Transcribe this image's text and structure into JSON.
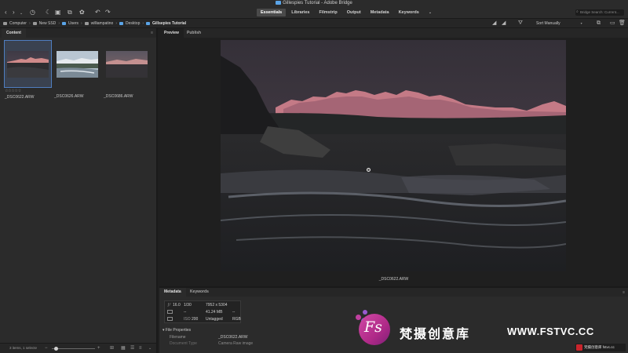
{
  "window": {
    "title": "Gillespies Tutorial - Adobe Bridge"
  },
  "toolbar": {
    "workspaces": [
      "Essentials",
      "Libraries",
      "Filmstrip",
      "Output",
      "Metadata",
      "Keywords"
    ],
    "active_workspace": "Essentials",
    "search_placeholder": "Bridge Search: Current..."
  },
  "pathbar": {
    "crumbs": [
      "Computer",
      "New SSD",
      "Users",
      "williampatino",
      "Desktop",
      "Gillsepies Tutorial"
    ],
    "sort_label": "Sort Manually"
  },
  "content_panel": {
    "tab": "Content",
    "items": [
      {
        "filename": "_DSC0622.ARW",
        "selected": true,
        "stars": "☆☆☆☆☆"
      },
      {
        "filename": "_DSC0626.ARW",
        "selected": false,
        "stars": ""
      },
      {
        "filename": "_DSC0686.ARW",
        "selected": false,
        "stars": ""
      }
    ],
    "status": "3 items, 1 selecte"
  },
  "preview_panel": {
    "tabs": [
      "Preview",
      "Publish"
    ],
    "active_tab": "Preview",
    "filename": "_DSC0622.ARW"
  },
  "metadata_panel": {
    "tabs": [
      "Metadata",
      "Keywords"
    ],
    "active_tab": "Metadata",
    "camera": {
      "aperture": "16.0",
      "shutter": "1/30",
      "dimensions": "7952 x 5304",
      "exposure_comp": "--",
      "file_size": "41.24 MB",
      "dpi": "--",
      "iso": "200",
      "label": "Untagged",
      "color_mode": "RGB"
    },
    "section": "File Properties",
    "rows": [
      {
        "label": "Filename",
        "value": "_DSC0622.ARW"
      },
      {
        "label": "Document Type",
        "value": "Camera Raw image"
      }
    ]
  },
  "watermark": {
    "chinese": "梵摄创意库",
    "site": "WWW.FSTVC.CC",
    "badge": "梵摄创意库 fstvc.cc"
  }
}
